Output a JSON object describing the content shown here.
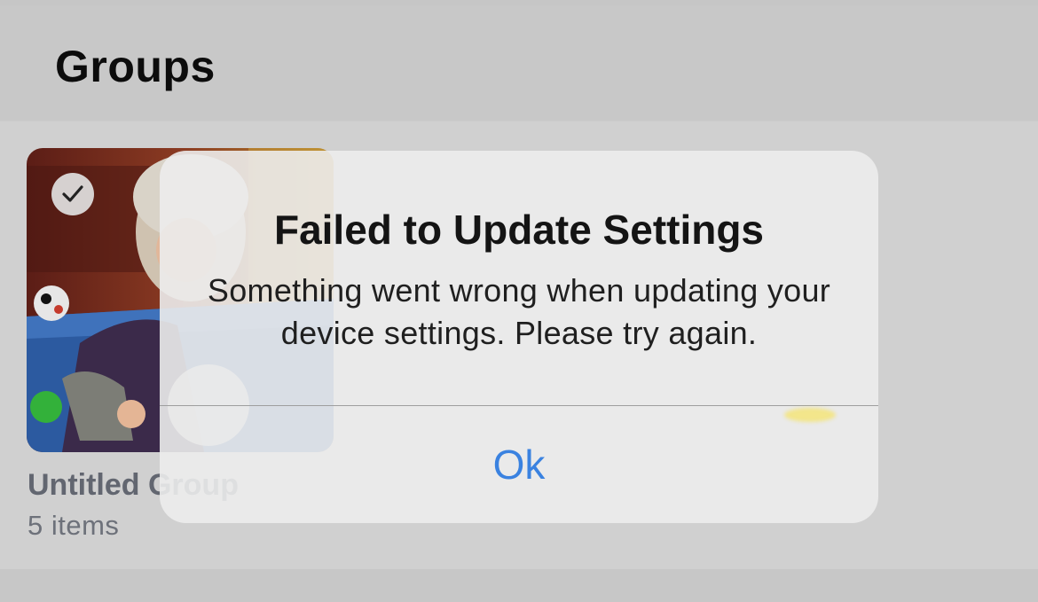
{
  "header": {
    "title": "Groups"
  },
  "group": {
    "name": "Untitled Group",
    "count": "5 items",
    "selected": true,
    "thumbnail_icon": "group-photo",
    "badge_icon": "checkmark-icon"
  },
  "alert": {
    "title": "Failed to Update Settings",
    "message": "Something went wrong when updating your device settings. Please try again.",
    "ok_label": "Ok"
  },
  "colors": {
    "accent": "#3a82e0",
    "title_text": "#0c0c0c",
    "group_name": "#626670",
    "background": "#cbcbcb"
  }
}
